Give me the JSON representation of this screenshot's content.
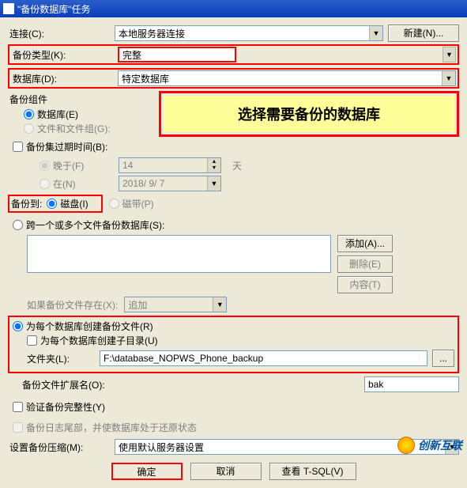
{
  "title": "\"备份数据库\"任务",
  "labels": {
    "connection": "连接(C):",
    "backupType": "备份类型(K):",
    "database": "数据库(D):",
    "backupComponents": "备份组件",
    "databaseRadio": "数据库(E)",
    "filesAndGroups": "文件和文件组(G):",
    "expiration": "备份集过期时间(B):",
    "after": "晚于(F)",
    "on": "在(N)",
    "days": "天",
    "backupTo": "备份到:",
    "disk": "磁盘(I)",
    "tape": "磁带(P)",
    "across": "跨一个或多个文件备份数据库(S):",
    "ifExists": "如果备份文件存在(X):",
    "createPerDb": "为每个数据库创建备份文件(R)",
    "createSubdir": "为每个数据库创建子目录(U)",
    "folder": "文件夹(L):",
    "extension": "备份文件扩展名(O):",
    "verify": "验证备份完整性(Y)",
    "tailLog": "备份日志尾部，并使数据库处于还原状态",
    "compression": "设置备份压缩(M):"
  },
  "values": {
    "connection": "本地服务器连接",
    "backupType": "完整",
    "database": "特定数据库",
    "expirationDays": "14",
    "expirationDate": "2018/ 9/ 7",
    "append": "追加",
    "folderPath": "F:\\database_NOPWS_Phone_backup",
    "extension": "bak",
    "compression": "使用默认服务器设置"
  },
  "buttons": {
    "new": "新建(N)...",
    "add": "添加(A)...",
    "remove": "删除(E)",
    "contents": "内容(T)",
    "browse": "...",
    "ok": "确定",
    "cancel": "取消",
    "viewTsql": "查看 T-SQL(V)"
  },
  "banner": "选择需要备份的数据库",
  "watermark": "创新互联"
}
